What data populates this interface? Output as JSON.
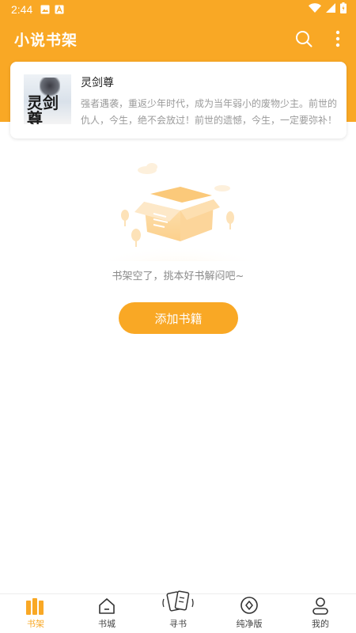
{
  "status_bar": {
    "time": "2:44",
    "left_icons": [
      "image-icon",
      "a-badge-icon"
    ],
    "right_icons": [
      "wifi-icon",
      "signal-icon",
      "battery-icon"
    ]
  },
  "header": {
    "title": "小说书架",
    "actions": [
      "search-icon",
      "more-vertical-icon"
    ]
  },
  "book": {
    "title": "灵剑尊",
    "description": "强者遇袭，重返少年时代，成为当年弱小的废物少主。前世的仇人，今生，绝不会放过！前世的遗憾，今生，一定要弥补！",
    "cover_text": "灵剑尊"
  },
  "empty_state": {
    "message": "书架空了，挑本好书解闷吧~",
    "button_label": "添加书籍"
  },
  "bottom_nav": {
    "items": [
      {
        "label": "书架",
        "icon": "bookshelf-icon",
        "active": true
      },
      {
        "label": "书城",
        "icon": "home-icon",
        "active": false
      },
      {
        "label": "寻书",
        "icon": "cards-icon",
        "active": false
      },
      {
        "label": "纯净版",
        "icon": "compass-icon",
        "active": false
      },
      {
        "label": "我的",
        "icon": "user-icon",
        "active": false
      }
    ]
  },
  "colors": {
    "accent": "#f9a825",
    "text_primary": "#222222",
    "text_secondary": "#9a9a9a"
  }
}
